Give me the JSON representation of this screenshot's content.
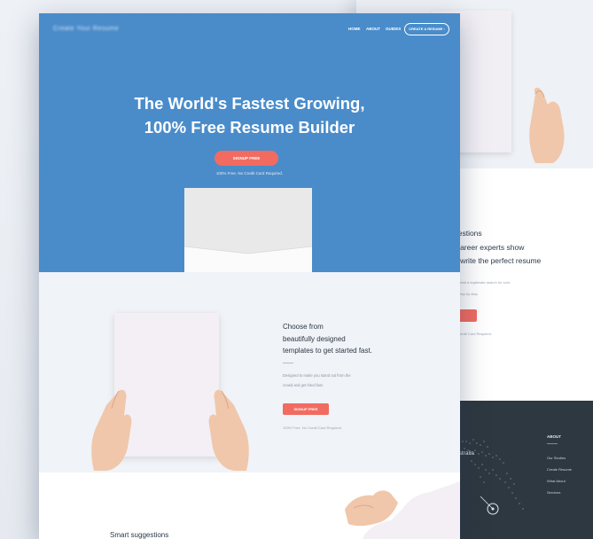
{
  "nav": {
    "links": [
      "HOME",
      "ABOUT",
      "GUIDES"
    ],
    "cta": "CREATE A RESUME ›",
    "logo_text": "Create Your Resume"
  },
  "hero": {
    "headline_line1": "The World's Fastest Growing,",
    "headline_line2": "100% Free Resume Builder",
    "button": "SIGNUP FREE",
    "note": "100% Free. No Credit Card Required."
  },
  "templates_section": {
    "title_line1": "Choose from",
    "title_line2": "beautifully designed",
    "title_line3": "templates to get started fast.",
    "desc_line1": "Designed to make you stand out from the",
    "desc_line2": "crowd and get hired fast.",
    "button": "SIGNUP FREE",
    "note": "100% Free. No Credit Card Required."
  },
  "suggestions_section": {
    "title": "Smart suggestions"
  },
  "back_page": {
    "create_button": "CREATE A RESUME ›",
    "title_line1": "gestions",
    "title_line2": "-career experts show",
    "title_line3": "o write the perfect resume",
    "desc_line1": "ng what a legitimate search for sure,",
    "desc_line2": "es step by step",
    "note": "Credit Card Required.",
    "map_label": "ustralia",
    "footer": {
      "title": "ABOUT",
      "links": [
        "Our Studies",
        "Create Resume",
        "What About",
        "Services"
      ]
    }
  },
  "colors": {
    "hero_blue": "#4a8cca",
    "accent_coral": "#f26b61",
    "footer_dark": "#2e3840"
  }
}
